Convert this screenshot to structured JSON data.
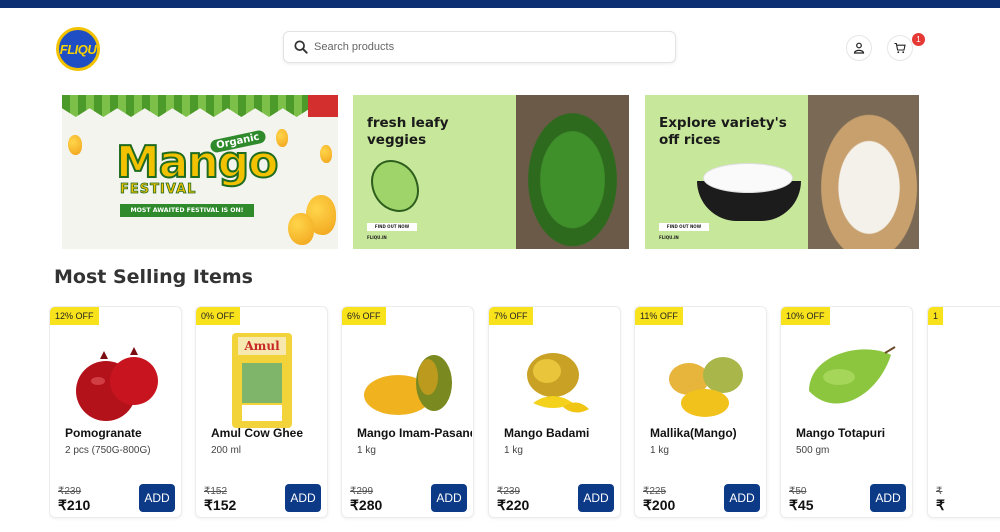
{
  "header": {
    "logo_text": "FLIQU",
    "search": {
      "placeholder": "Search products"
    },
    "cart_count": "1"
  },
  "banners": [
    {
      "organic": "Organic",
      "title": "Mango",
      "subtitle": "FESTIVAL",
      "ribbon": "MOST AWAITED FESTIVAL IS ON!"
    },
    {
      "title_line1": "fresh leafy",
      "title_line2": "veggies",
      "button": "FIND OUT NOW",
      "brand": "FLIQU.IN"
    },
    {
      "title_line1": "Explore variety's",
      "title_line2": "off rices",
      "button": "FIND OUT NOW",
      "brand": "FLIQU.IN"
    }
  ],
  "section_title": "Most Selling Items",
  "products": [
    {
      "discount": "12% OFF",
      "name": "Pomogranate",
      "qty": "2 pcs (750G-800G)",
      "mrp": "₹239",
      "price": "₹210",
      "add": "ADD",
      "icon": "pomegranate"
    },
    {
      "discount": "0% OFF",
      "name": "Amul Cow Ghee",
      "qty": "200 ml",
      "mrp": "₹152",
      "price": "₹152",
      "add": "ADD",
      "icon": "ghee-pouch"
    },
    {
      "discount": "6% OFF",
      "name": "Mango Imam-Pasand",
      "qty": "1 kg",
      "mrp": "₹299",
      "price": "₹280",
      "add": "ADD",
      "icon": "mango"
    },
    {
      "discount": "7% OFF",
      "name": "Mango Badami",
      "qty": "1 kg",
      "mrp": "₹239",
      "price": "₹220",
      "add": "ADD",
      "icon": "mango"
    },
    {
      "discount": "11% OFF",
      "name": "Mallika(Mango)",
      "qty": "1 kg",
      "mrp": "₹225",
      "price": "₹200",
      "add": "ADD",
      "icon": "mango"
    },
    {
      "discount": "10% OFF",
      "name": "Mango Totapuri",
      "qty": "500 gm",
      "mrp": "₹50",
      "price": "₹45",
      "add": "ADD",
      "icon": "green-mango"
    },
    {
      "discount": "1",
      "name": "",
      "qty": "",
      "mrp": "₹",
      "price": "₹",
      "add": "",
      "icon": "partial"
    }
  ]
}
